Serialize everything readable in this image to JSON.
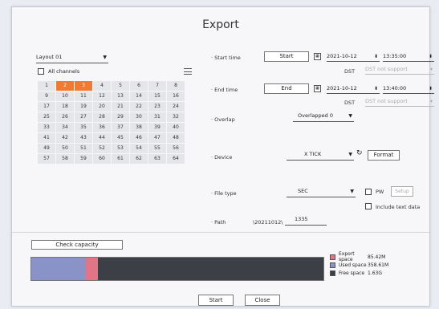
{
  "dialog": {
    "title": "Export"
  },
  "left": {
    "layout_value": "Layout 01",
    "all_channels_label": "All channels",
    "channels": [
      "1",
      "2",
      "3",
      "4",
      "5",
      "6",
      "7",
      "8",
      "9",
      "10",
      "11",
      "12",
      "13",
      "14",
      "15",
      "16",
      "17",
      "18",
      "19",
      "20",
      "21",
      "22",
      "23",
      "24",
      "25",
      "26",
      "27",
      "28",
      "29",
      "30",
      "31",
      "32",
      "33",
      "34",
      "35",
      "36",
      "37",
      "38",
      "39",
      "40",
      "41",
      "42",
      "43",
      "44",
      "45",
      "46",
      "47",
      "48",
      "49",
      "50",
      "51",
      "52",
      "53",
      "54",
      "55",
      "56",
      "57",
      "58",
      "59",
      "60",
      "61",
      "62",
      "63",
      "64"
    ],
    "selected_channels": [
      "2",
      "3"
    ],
    "selected_color": "#f07a31"
  },
  "start_time": {
    "label": "Start time",
    "button": "Start",
    "date": "2021-10-12",
    "time": "13:35:00",
    "dst_label": "DST",
    "dst_placeholder": "DST not support"
  },
  "end_time": {
    "label": "End time",
    "button": "End",
    "date": "2021-10-12",
    "time": "13:40:00",
    "dst_label": "DST",
    "dst_placeholder": "DST not support"
  },
  "overlap": {
    "label": "Overlap",
    "value": "Overlapped 0"
  },
  "device": {
    "label": "Device",
    "value": "X TICK",
    "format_button": "Format"
  },
  "file_type": {
    "label": "File type",
    "value": "SEC",
    "pw_label": "PW",
    "pw_button": "Setup",
    "include_text_label": "Include text data"
  },
  "path": {
    "label": "Path",
    "prefix": "\\20211012\\",
    "value": "1335"
  },
  "capacity": {
    "button": "Check capacity",
    "used_fraction": 0.188,
    "export_fraction": 0.04,
    "legend": [
      {
        "name": "Export space",
        "value": "85.42M",
        "color": "#e07585"
      },
      {
        "name": "Used space",
        "value": "358.61M",
        "color": "#8a93c8"
      },
      {
        "name": "Free space",
        "value": "1.63G",
        "color": "#3c3f45"
      }
    ]
  },
  "footer": {
    "start_button": "Start",
    "close_button": "Close"
  }
}
